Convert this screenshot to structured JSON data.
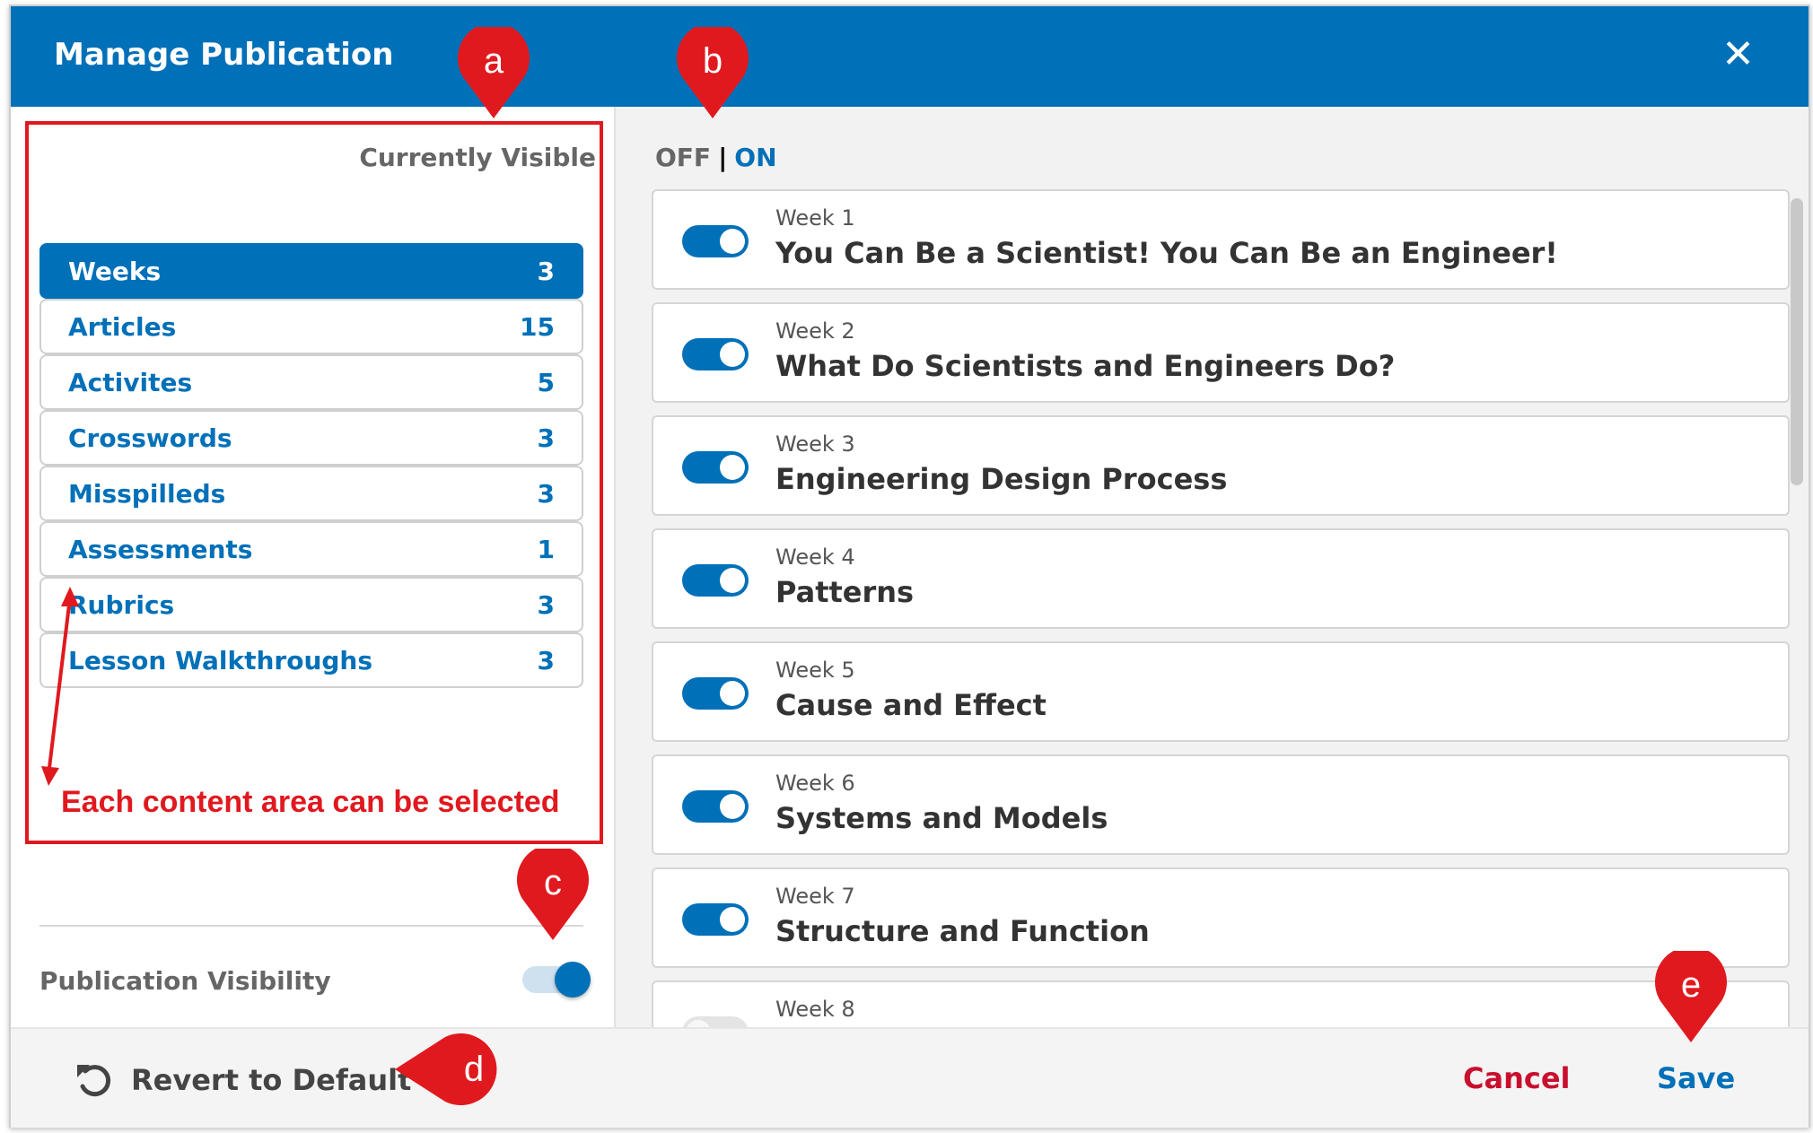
{
  "dialog": {
    "title": "Manage Publication",
    "close_icon_char": "✕"
  },
  "sidebar": {
    "header": "Currently Visible",
    "items": [
      {
        "label": "Weeks",
        "count": "3",
        "active": true
      },
      {
        "label": "Articles",
        "count": "15",
        "active": false
      },
      {
        "label": "Activites",
        "count": "5",
        "active": false
      },
      {
        "label": "Crosswords",
        "count": "3",
        "active": false
      },
      {
        "label": "Misspilleds",
        "count": "3",
        "active": false
      },
      {
        "label": "Assessments",
        "count": "1",
        "active": false
      },
      {
        "label": "Rubrics",
        "count": "3",
        "active": false
      },
      {
        "label": "Lesson Walkthroughs",
        "count": "3",
        "active": false
      }
    ],
    "publication_visibility_label": "Publication Visibility",
    "publication_visibility_on": true
  },
  "toggle_legend": {
    "off": "OFF",
    "separator": "|",
    "on": "ON"
  },
  "weeks": [
    {
      "number": "Week 1",
      "title": "You Can Be a Scientist! You Can Be an Engineer!",
      "on": true
    },
    {
      "number": "Week 2",
      "title": "What Do Scientists and Engineers Do?",
      "on": true
    },
    {
      "number": "Week 3",
      "title": "Engineering Design Process",
      "on": true
    },
    {
      "number": "Week 4",
      "title": "Patterns",
      "on": true
    },
    {
      "number": "Week 5",
      "title": "Cause and Effect",
      "on": true
    },
    {
      "number": "Week 6",
      "title": "Systems and Models",
      "on": true
    },
    {
      "number": "Week 7",
      "title": "Structure and Function",
      "on": true
    },
    {
      "number": "Week 8",
      "title": "",
      "on": false
    }
  ],
  "footer": {
    "revert_label": "Revert to Default",
    "cancel_label": "Cancel",
    "save_label": "Save"
  },
  "annotations": {
    "note": "Each content area can be selected",
    "markers": {
      "a": "a",
      "b": "b",
      "c": "c",
      "d": "d",
      "e": "e"
    },
    "color": "#e0191f"
  },
  "colors": {
    "primary": "#0070b8",
    "cancel": "#c8102e",
    "annotation": "#e0191f"
  }
}
